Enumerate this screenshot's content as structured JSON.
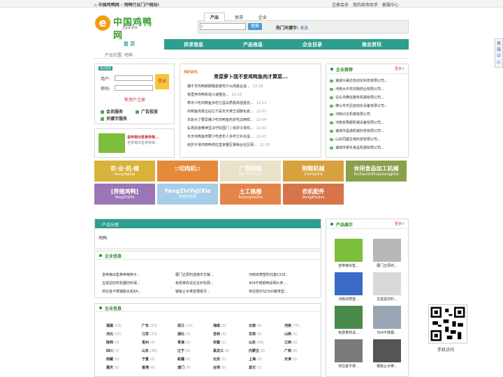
{
  "topbar": {
    "home_text": "中国鸡鸭网 - 鸡鸭行业门户网站!",
    "links": [
      "注册会员",
      "我的商务助手",
      "客服中心"
    ]
  },
  "logo": {
    "cn": "中国鸡鸭网",
    "en": "Jiya.biz",
    "mark": "e"
  },
  "search": {
    "tabs": [
      "产品",
      "供求",
      "企业"
    ],
    "button": "搜索",
    "hot_label": "热门关键字:",
    "hot_keyword": "食品"
  },
  "nav": [
    "首 页",
    "供求信息",
    "产品信息",
    "企业目录",
    "商业资讯"
  ],
  "breadcrumb": "产品位置: 鸡鸭",
  "login": {
    "title": "会员登录",
    "user_label": "用户:",
    "pass_label": "密码:",
    "login_btn": "登录",
    "register": "新用户注册",
    "links": [
      "会员服务",
      "广告投放",
      "关键字服务"
    ]
  },
  "ad": {
    "title": "皇帝菊出售黄帝菊...",
    "desc": "皇帝菊出售黄帝菊..."
  },
  "news": {
    "tag": "NEWS",
    "headline": "青菜萝卜我不爱鸡鸭鱼肉才算菜...",
    "items": [
      {
        "t": "猪牛羊鸡鸭鹅肺瘤患者吃什么肉最合适...",
        "d": "12-18"
      },
      {
        "t": "我里养鸡鸭街道火速整治...",
        "d": "12-15"
      },
      {
        "t": "寒冬少吃鸡鸭鱼多吃它蛋白质极高强抵抗...",
        "d": "12-13"
      },
      {
        "t": "鸡鸭鱼肉靠边站它才是冬天菜王润肺化痰...",
        "d": "12-07"
      },
      {
        "t": "年龄大了要忌嘴少吃鸡鸭鱼肉多吃这两样...",
        "d": "12-04"
      },
      {
        "t": "弘扬抗疫精神坚决守好国门丨绽护子禧鸡...",
        "d": "12-02"
      },
      {
        "t": "冬天鸡鸭鱼肉要少吃老年人多吃它补充蛋...",
        "d": "12-01"
      },
      {
        "t": "绽护子禧鸡鸭鸭供应皇家雅区钢噪台社区网...",
        "d": "11-30"
      }
    ]
  },
  "recommend": {
    "title": "企业推荐",
    "more": "更多>",
    "items": [
      "诸城众晟达自动化科技有限公司...",
      "河南大中农动物药业有限公司...",
      "泊头市腾信畜牧机械有限公司...",
      "佛山市杰迅自动化设备有限公司...",
      "河南兴达机械有限公司",
      "河南省豫都机械设备有限公司...",
      "诸城市昌通机械科技有限公司...",
      "山东同盛生物科技有限公司...",
      "诸城市吴东食品机械有限公司..."
    ]
  },
  "banners": [
    {
      "t": "农·业·机·械",
      "s": "NongYeJiXie",
      "c": "#d9b23a"
    },
    {
      "t": "::切肉机::",
      "s": "",
      "c": "#e58a3a"
    },
    {
      "t": "广告招租",
      "s": "400-703-2221",
      "c": "#e8e2c8"
    },
    {
      "t": "制鞋机械",
      "s": "ZhiXieJiXie",
      "c": "#d7a23e"
    },
    {
      "t": "休闲食品加工机械",
      "s": "XiuXianShiPinJiaGongJiXie",
      "c": "#8aa04a"
    },
    {
      "t": "[养殖鸡鸭]",
      "s": "YangZhiJiYa",
      "c": "#9a76b6"
    },
    {
      "t": "YangZhiYeJiXie",
      "s": "养殖业机械",
      "c": "#a7cde8"
    },
    {
      "t": "土工格栅",
      "s": "TuGongGeZha",
      "c": "#e3844a"
    },
    {
      "t": "农机配件",
      "s": "NongJiPeiJian",
      "c": "#d6744a"
    }
  ],
  "category": {
    "title": "产品分类",
    "item": "鸡鸭"
  },
  "company": {
    "title": "企业信息",
    "items": [
      "皇帝菊出售黄帝菊种子...",
      "厦门正辰的连接市文裁...",
      "河南双菱塑料托盘131E...",
      "五挺拍饮料机器饮料保...",
      "免费革样设拉近炉松网...",
      "304不锈钢电焊网片养...",
      "供应金不锈钢脱水机6A...",
      "钢板止水带直槽铣牙...",
      "供应阻尔SZ300聚苯型..."
    ]
  },
  "region": {
    "title": "企业信息",
    "items": [
      {
        "n": "福建",
        "c": "(23)"
      },
      {
        "n": "广东",
        "c": "(23)"
      },
      {
        "n": "浙江",
        "c": "(13)"
      },
      {
        "n": "海南",
        "c": "(0)"
      },
      {
        "n": "云南",
        "c": "(0)"
      },
      {
        "n": "河南",
        "c": "(75)"
      },
      {
        "n": "河北",
        "c": "(15)"
      },
      {
        "n": "江苏",
        "c": "(13)"
      },
      {
        "n": "湖北",
        "c": "(2)"
      },
      {
        "n": "吉林",
        "c": "(0)"
      },
      {
        "n": "甘肃",
        "c": "(0)"
      },
      {
        "n": "山西",
        "c": "(1)"
      },
      {
        "n": "陕西",
        "c": "(3)"
      },
      {
        "n": "贵州",
        "c": "(0)"
      },
      {
        "n": "青海",
        "c": "(0)"
      },
      {
        "n": "安徽",
        "c": "(1)"
      },
      {
        "n": "山东",
        "c": "(56)"
      },
      {
        "n": "江西",
        "c": "(0)"
      },
      {
        "n": "四川",
        "c": "(1)"
      },
      {
        "n": "山东",
        "c": "(26)"
      },
      {
        "n": "辽宁",
        "c": "(0)"
      },
      {
        "n": "黑龙江",
        "c": "(0)"
      },
      {
        "n": "内蒙古",
        "c": "(0)"
      },
      {
        "n": "广西",
        "c": "(0)"
      },
      {
        "n": "西藏",
        "c": "(0)"
      },
      {
        "n": "宁夏",
        "c": "(0)"
      },
      {
        "n": "新疆",
        "c": "(0)"
      },
      {
        "n": "北京",
        "c": "(1)"
      },
      {
        "n": "上海",
        "c": "(3)"
      },
      {
        "n": "天津",
        "c": "(1)"
      },
      {
        "n": "重庆",
        "c": "(0)"
      },
      {
        "n": "香港",
        "c": "(0)"
      },
      {
        "n": "澳门",
        "c": "(0)"
      },
      {
        "n": "台湾",
        "c": "(0)"
      },
      {
        "n": "其它",
        "c": "(1)"
      }
    ]
  },
  "products": {
    "title": "产品展示",
    "more": "更多>",
    "items": [
      {
        "l": "皇帝菊出售...",
        "c": "#7dbe3c"
      },
      {
        "l": "厦门正辰的...",
        "c": "#b8b8b8"
      },
      {
        "l": "河南双菱塑...",
        "c": "#3a6ac8"
      },
      {
        "l": "五挺拍饮料...",
        "c": "#d9d9d9"
      },
      {
        "l": "免费革样设...",
        "c": "#4a8a4a"
      },
      {
        "l": "304不锈钢...",
        "c": "#9aa6b4"
      },
      {
        "l": "供应金不锈...",
        "c": "#7a7a7a"
      },
      {
        "l": "钢板止水带...",
        "c": "#555555"
      }
    ]
  },
  "side_tab": "客服中心",
  "qr": {
    "label": "手机访问"
  }
}
